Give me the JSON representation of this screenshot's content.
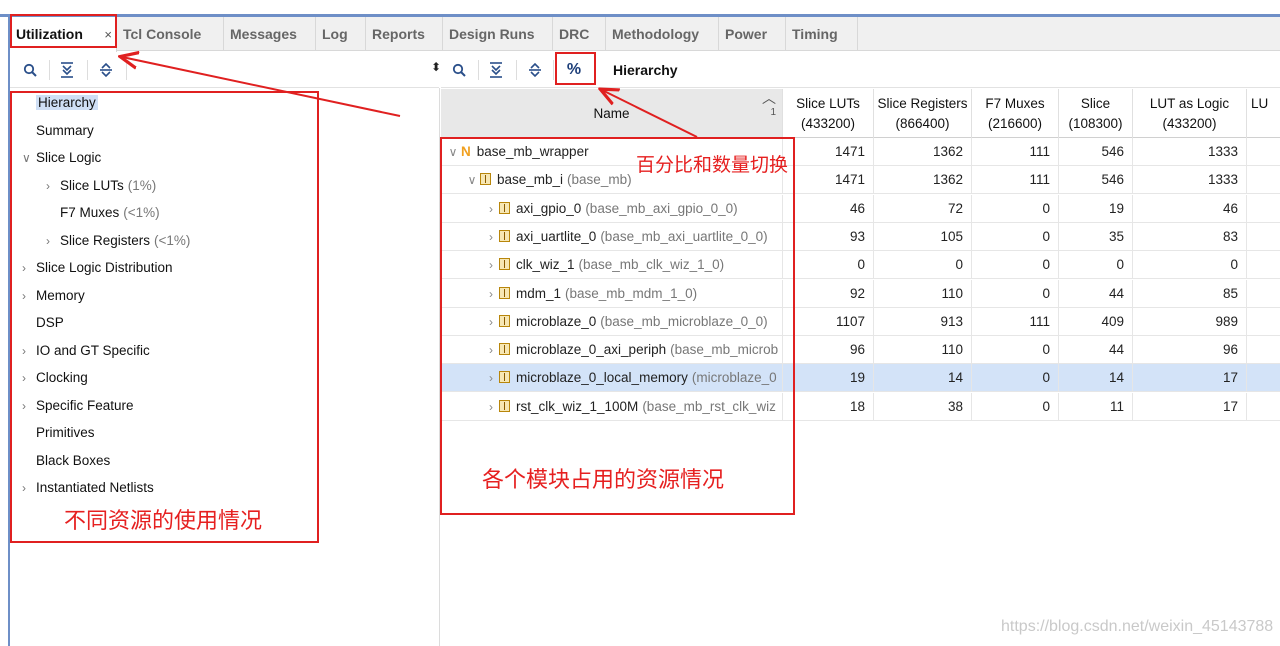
{
  "tabs": [
    {
      "label": "Utilization",
      "active": true
    },
    {
      "label": "Tcl Console"
    },
    {
      "label": "Messages"
    },
    {
      "label": "Log"
    },
    {
      "label": "Reports"
    },
    {
      "label": "Design Runs"
    },
    {
      "label": "DRC"
    },
    {
      "label": "Methodology"
    },
    {
      "label": "Power"
    },
    {
      "label": "Timing"
    }
  ],
  "tab_close": "×",
  "right_toolbar": {
    "percent_label": "%",
    "view_label": "Hierarchy"
  },
  "left_tree": [
    {
      "label": "Hierarchy",
      "selected": true
    },
    {
      "label": "Summary"
    },
    {
      "label": "Slice Logic",
      "expanded": true
    },
    {
      "label": "Slice LUTs",
      "pct": "(1%)",
      "indent": 1
    },
    {
      "label": "F7 Muxes",
      "pct": "(<1%)",
      "indent": 1
    },
    {
      "label": "Slice Registers",
      "pct": "(<1%)",
      "indent": 1
    },
    {
      "label": "Slice Logic Distribution"
    },
    {
      "label": "Memory"
    },
    {
      "label": "DSP"
    },
    {
      "label": "IO and GT Specific"
    },
    {
      "label": "Clocking"
    },
    {
      "label": "Specific Feature"
    },
    {
      "label": "Primitives"
    },
    {
      "label": "Black Boxes"
    },
    {
      "label": "Instantiated Netlists"
    }
  ],
  "table": {
    "sort_indicator": "1",
    "columns": [
      {
        "l1": "Name",
        "l2": ""
      },
      {
        "l1": "Slice LUTs",
        "l2": "(433200)"
      },
      {
        "l1": "Slice Registers",
        "l2": "(866400)"
      },
      {
        "l1": "F7 Muxes",
        "l2": "(216600)"
      },
      {
        "l1": "Slice",
        "l2": "(108300)"
      },
      {
        "l1": "LUT as Logic",
        "l2": "(433200)"
      },
      {
        "l1": "LU",
        "l2": ""
      }
    ],
    "rows": [
      {
        "name": "base_mb_wrapper",
        "ref": "",
        "vals": [
          "1471",
          "1362",
          "111",
          "546",
          "1333"
        ]
      },
      {
        "name": "base_mb_i",
        "ref": "(base_mb)",
        "vals": [
          "1471",
          "1362",
          "111",
          "546",
          "1333"
        ]
      },
      {
        "name": "axi_gpio_0",
        "ref": "(base_mb_axi_gpio_0_0)",
        "vals": [
          "46",
          "72",
          "0",
          "19",
          "46"
        ]
      },
      {
        "name": "axi_uartlite_0",
        "ref": "(base_mb_axi_uartlite_0_0)",
        "vals": [
          "93",
          "105",
          "0",
          "35",
          "83"
        ]
      },
      {
        "name": "clk_wiz_1",
        "ref": "(base_mb_clk_wiz_1_0)",
        "vals": [
          "0",
          "0",
          "0",
          "0",
          "0"
        ]
      },
      {
        "name": "mdm_1",
        "ref": "(base_mb_mdm_1_0)",
        "vals": [
          "92",
          "110",
          "0",
          "44",
          "85"
        ]
      },
      {
        "name": "microblaze_0",
        "ref": "(base_mb_microblaze_0_0)",
        "vals": [
          "1107",
          "913",
          "111",
          "409",
          "989"
        ]
      },
      {
        "name": "microblaze_0_axi_periph",
        "ref": "(base_mb_microb",
        "vals": [
          "96",
          "110",
          "0",
          "44",
          "96"
        ]
      },
      {
        "name": "microblaze_0_local_memory",
        "ref": "(microblaze_0",
        "vals": [
          "19",
          "14",
          "0",
          "14",
          "17"
        ],
        "highlight": true
      },
      {
        "name": "rst_clk_wiz_1_100M",
        "ref": "(base_mb_rst_clk_wiz",
        "vals": [
          "18",
          "38",
          "0",
          "11",
          "17"
        ]
      }
    ]
  },
  "annotations": {
    "toggle": "百分比和数量切换",
    "modules": "各个模块占用的资源情况",
    "resources": "不同资源的使用情况"
  },
  "watermark": "https://blog.csdn.net/weixin_45143788",
  "colors": {
    "annotation_red": "#e02020",
    "selection_blue": "#d3e3f8",
    "frame_blue": "#6e8fc7"
  }
}
